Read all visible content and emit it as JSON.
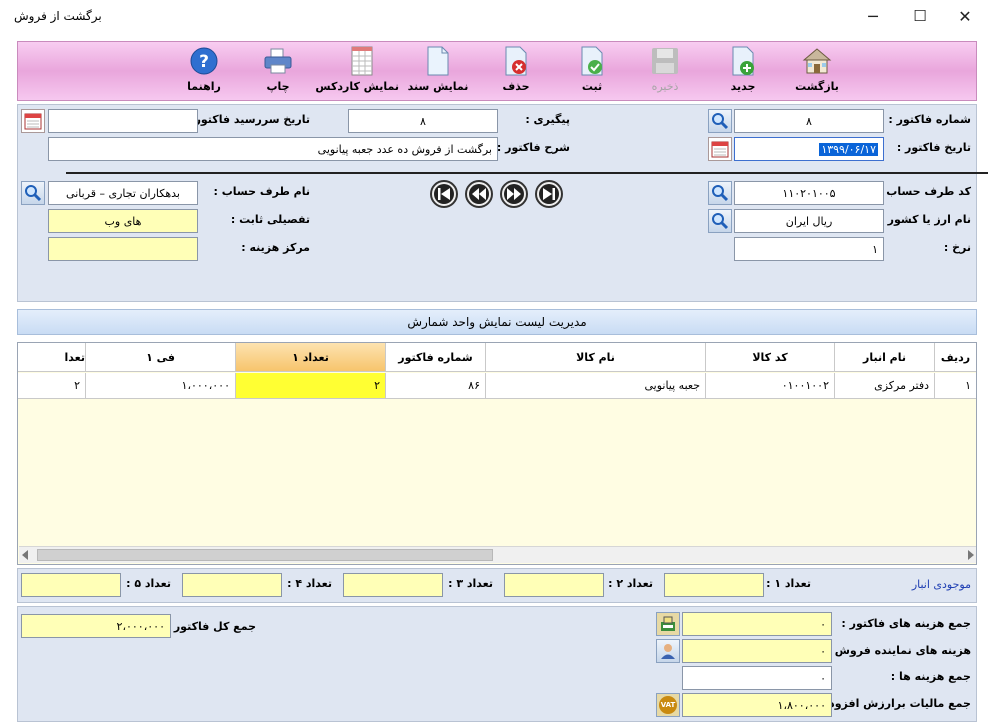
{
  "window": {
    "title": "برگشت از فروش",
    "minimize": "─",
    "maximize": "☐",
    "close": "✕"
  },
  "toolbar": {
    "back": "بازگشت",
    "new": "جدید",
    "save": "ذخیره",
    "register": "ثبت",
    "delete": "حذف",
    "show_document": "نمایش سند",
    "show_cardex": "نمایش کاردکس",
    "print": "چاپ",
    "help": "راهنما"
  },
  "header": {
    "invoice_number_label": "شماره فاکتور :",
    "invoice_number": "۸",
    "invoice_date_label": "تاریخ فاکتور :",
    "invoice_date": "۱۳۹۹/۰۶/۱۷",
    "followup_label": "پیگیری :",
    "followup": "۸",
    "due_date_label": "تاریخ سررسید فاکتور :",
    "due_date": "",
    "description_label": "شرح فاکتور :",
    "description": "برگشت از فروش ده عدد جعبه پیانویی",
    "account_code_label": "کد طرف حساب :",
    "account_code": "۱۱۰۲۰۱۰۰۵",
    "account_name_label": "نام طرف حساب :",
    "account_name": "بدهکاران تجاری – قربانی",
    "currency_label": "نام ارز یا کشور :",
    "currency": "ریال ایران",
    "detail_label": "تفصیلی ثابت :",
    "detail": "های وب",
    "rate_label": "نرخ :",
    "rate": "۱",
    "cost_center_label": "مرکز هزینه :",
    "cost_center": ""
  },
  "list_bar": {
    "label": "مدیریت لیست نمایش واحد شمارش"
  },
  "grid": {
    "columns": [
      "ردیف",
      "نام انبار",
      "کد کالا",
      "نام کالا",
      "شماره فاکتور",
      "تعداد ۱",
      "فی ۱",
      "تعدا"
    ],
    "rows": [
      {
        "row": "۱",
        "warehouse": "دفتر مرکزی",
        "code": "۰۱۰۰۱۰۰۲",
        "name": "جعبه پیانویی",
        "invoice_no": "۸۶",
        "qty1": "۲",
        "price1": "۱،۰۰۰،۰۰۰",
        "qty_cut": "۲"
      }
    ]
  },
  "inventory": {
    "title": "موجودی انبار",
    "qty1_label": "تعداد ۱ :",
    "qty2_label": "تعداد ۲ :",
    "qty3_label": "تعداد ۳ :",
    "qty4_label": "تعداد ۴ :",
    "qty5_label": "تعداد ۵ :",
    "qty1": "",
    "qty2": "",
    "qty3": "",
    "qty4": "",
    "qty5": ""
  },
  "totals": {
    "invoice_costs_label": "جمع هزینه های فاکتور :",
    "invoice_costs": "۰",
    "agent_costs_label": "هزینه های نماینده فروش :",
    "agent_costs": "۰",
    "total_costs_label": "جمع هزینه ها :",
    "total_costs": "۰",
    "vat_label": "جمع مالیات برارزش افزوده :",
    "vat": "۱،۸۰۰،۰۰۰",
    "grand_total_label": "جمع کل فاکتور :",
    "grand_total": "۲،۰۰۰،۰۰۰",
    "vat_badge": "VAT"
  },
  "colors": {
    "toolbar_top": "#f8cdf1",
    "panel_bg": "#dfe6f2",
    "yellow_field": "#ffffb7",
    "grid_bg": "#fffde3",
    "active_cell": "#ffff33",
    "inventory_title": "#1f3fb3"
  }
}
